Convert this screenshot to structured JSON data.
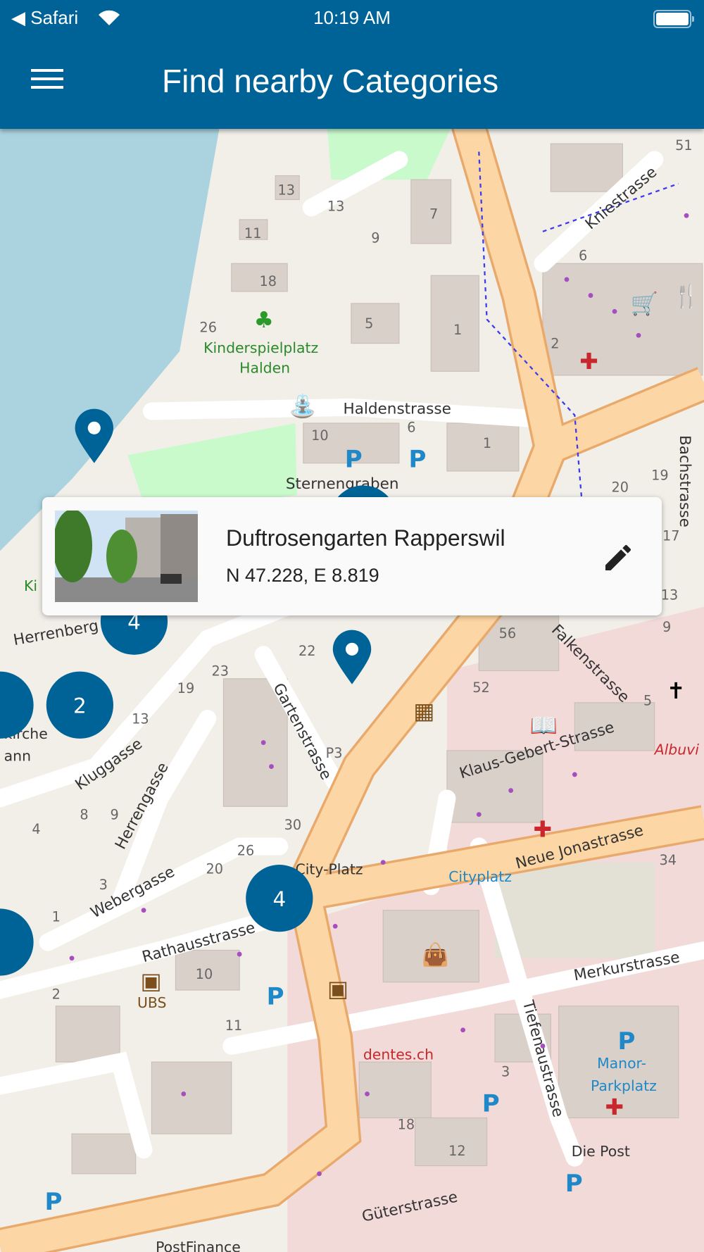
{
  "status_bar": {
    "back_app": "Safari",
    "time": "10:19 AM"
  },
  "header": {
    "title": "Find nearby Categories"
  },
  "popup": {
    "title": "Duftrosengarten Rapperswil",
    "coordinates": "N 47.228, E 8.819"
  },
  "colors": {
    "primary": "#006397",
    "road_major": "#fcd6a4",
    "water": "#aad3df",
    "park": "#c8facc"
  },
  "clusters": [
    "4",
    "2",
    "4"
  ],
  "map": {
    "streets": [
      "Haldenstrasse",
      "Sternengraben",
      "Kniestrasse",
      "Bachstrasse",
      "Falkenstrasse",
      "Klaus-Gebert-Strasse",
      "Neue Jonastrasse",
      "Gartenstrasse",
      "Kluggasse",
      "Herrengasse",
      "Webergasse",
      "Rathausstrasse",
      "Merkurstrasse",
      "Tiefenaustrasse",
      "Güterstrasse",
      "Herrenberg"
    ],
    "places": [
      "Kinderspielplatz",
      "Halden",
      "City-Platz",
      "Cityplatz",
      "UBS",
      "dentes.ch",
      "Manor-",
      "Parkplatz",
      "Die Post",
      "PostFinance",
      "Albuvi",
      "kirche",
      "ann",
      "Ki"
    ],
    "house_numbers": [
      "13",
      "13",
      "11",
      "18",
      "26",
      "5",
      "7",
      "9",
      "1",
      "10",
      "6",
      "1",
      "2",
      "51",
      "6",
      "20",
      "19",
      "17",
      "13",
      "9",
      "56",
      "52",
      "5",
      "22",
      "23",
      "19",
      "13",
      "P3",
      "30",
      "26",
      "20",
      "34",
      "10",
      "11",
      "18",
      "12",
      "3",
      "9",
      "8",
      "4",
      "3",
      "1",
      "2"
    ]
  }
}
